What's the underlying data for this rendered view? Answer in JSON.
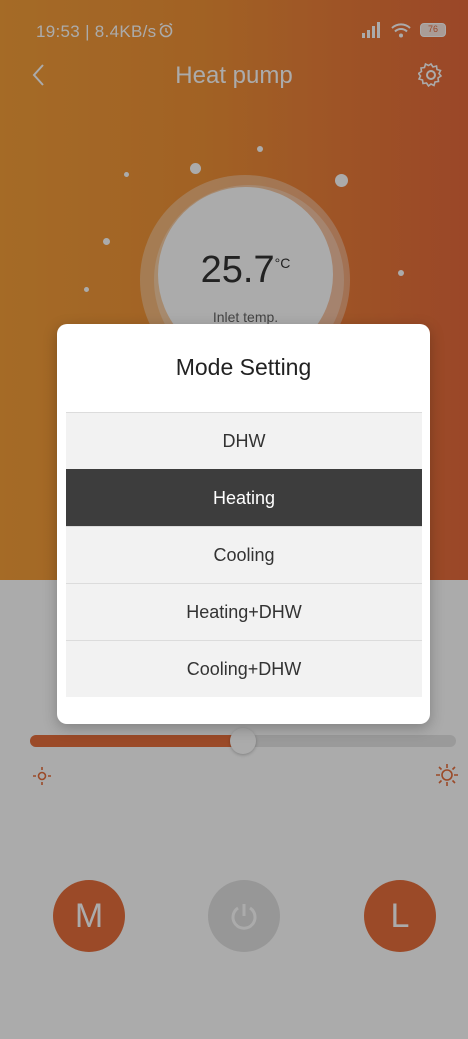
{
  "status_bar": {
    "time": "19:53 | 8.4KB/s",
    "battery": "76"
  },
  "header": {
    "title": "Heat pump"
  },
  "reading": {
    "value": "25.7",
    "unit": "°C",
    "label": "Inlet temp."
  },
  "slider": {
    "level_fraction": 0.5
  },
  "buttons": {
    "mode": "M",
    "power": "⏻",
    "low": "L"
  },
  "dialog": {
    "title": "Mode Setting",
    "options": [
      "DHW",
      "Heating",
      "Cooling",
      "Heating+DHW",
      "Cooling+DHW"
    ],
    "selected_index": 1
  },
  "colors": {
    "accent": "#e86f3c",
    "hero_left": "#f6a03a",
    "hero_right": "#e76a3c",
    "selected_option": "#3d3d3d"
  }
}
